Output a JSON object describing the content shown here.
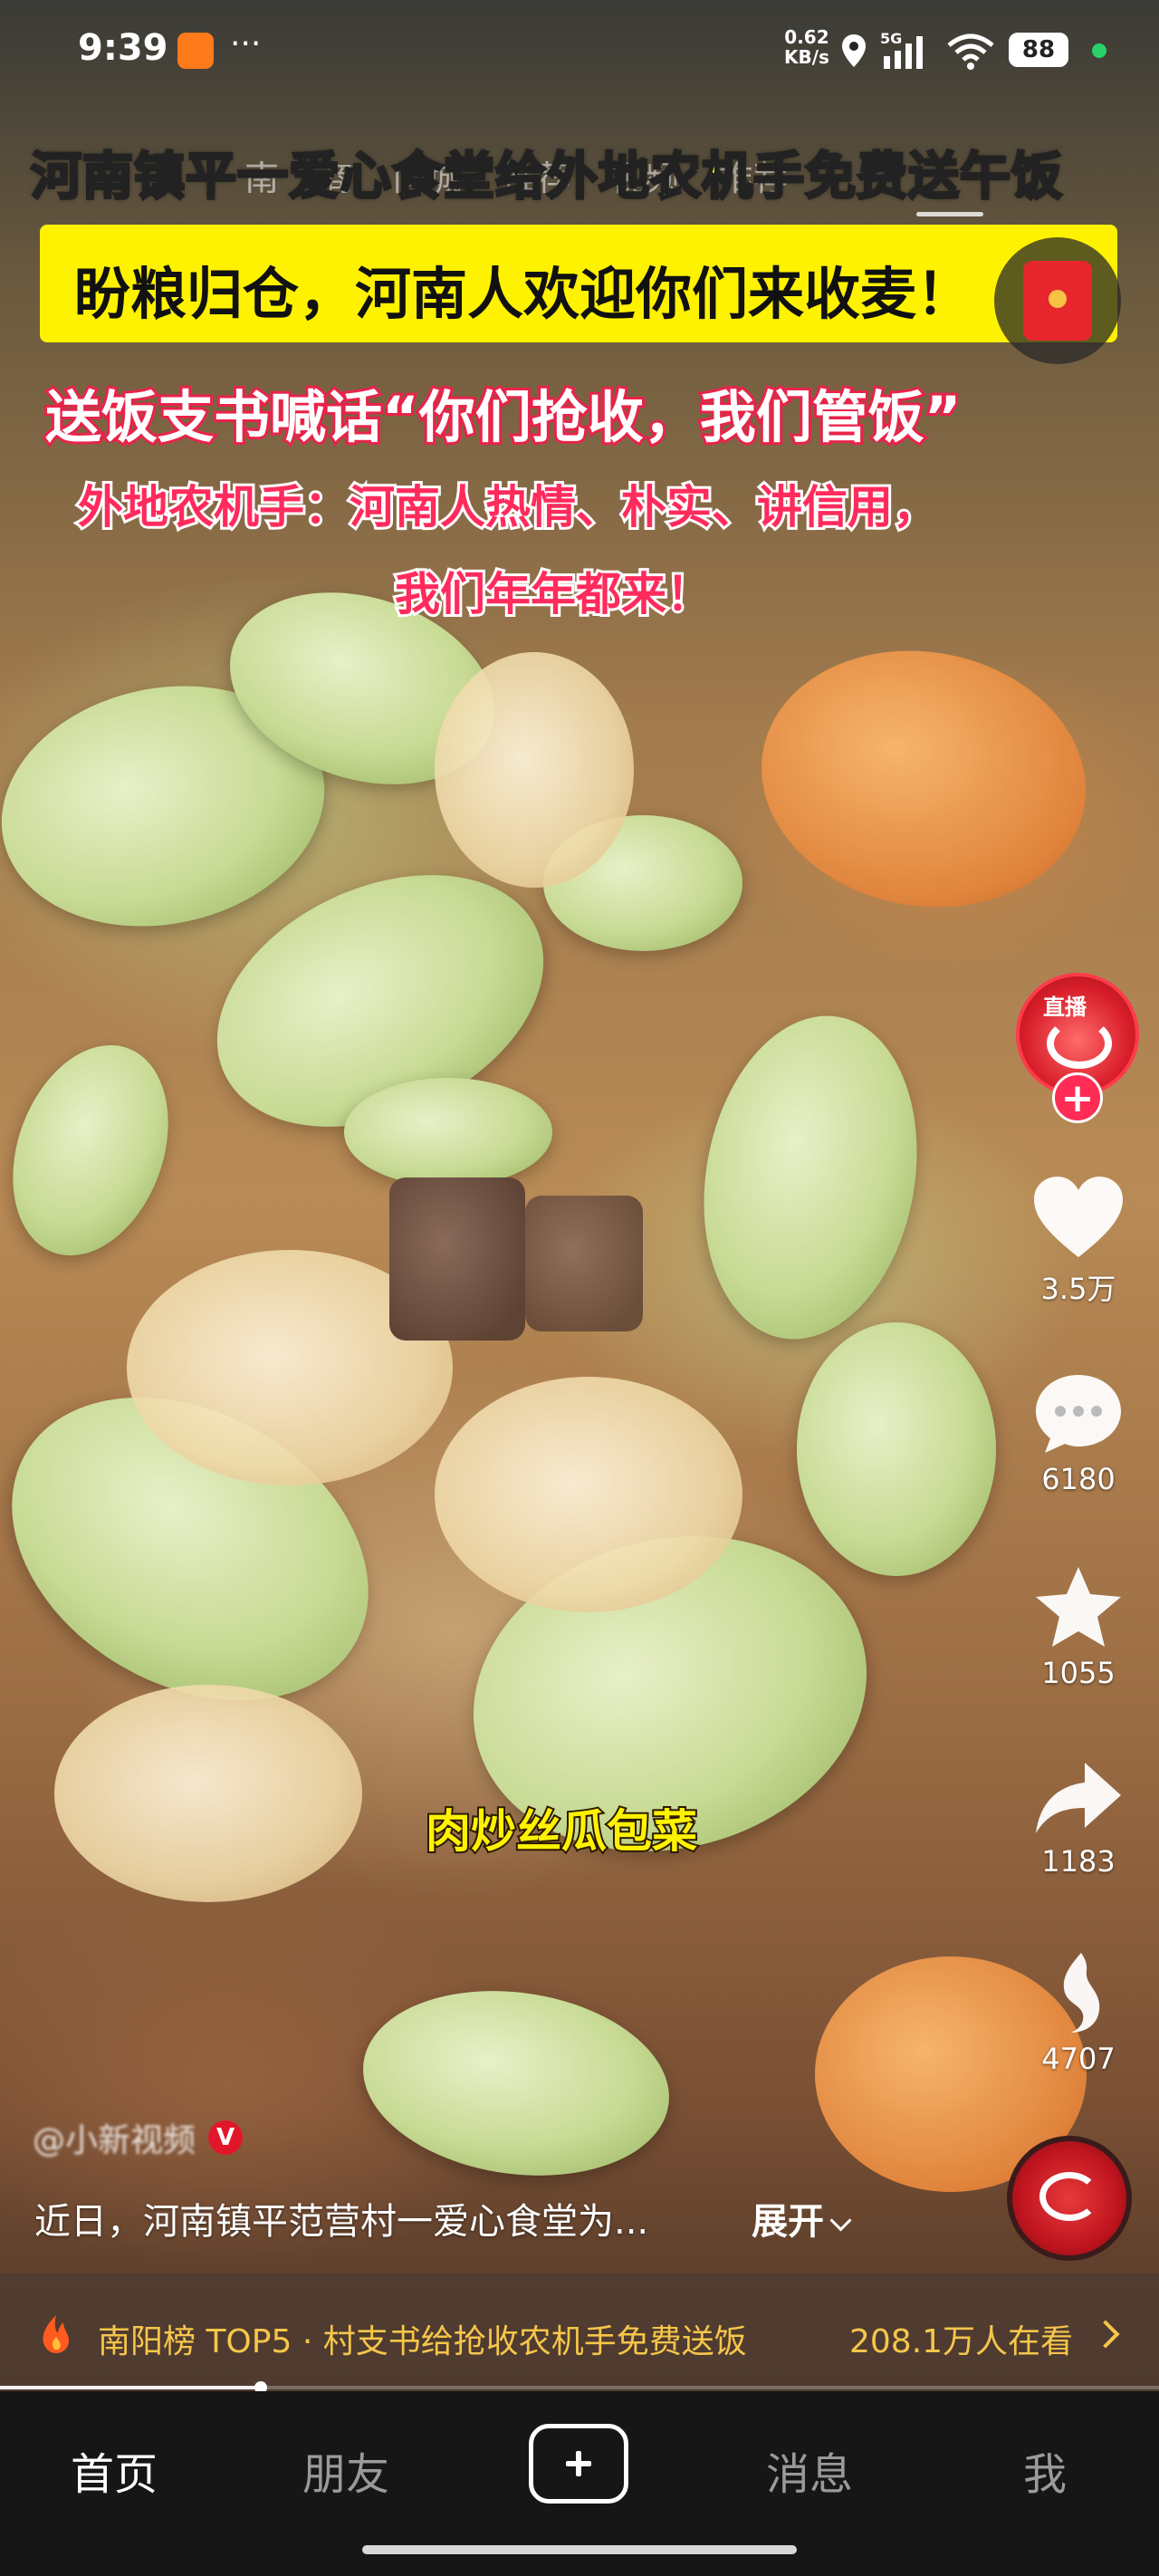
{
  "status_bar": {
    "time": "9:39",
    "dots": "···",
    "net_speed_value": "0.62",
    "net_speed_unit": "KB/s",
    "network": "5G",
    "battery": "88"
  },
  "top_tabs": [
    "南",
    "商",
    "同城",
    "推荐",
    "视频",
    "推荐"
  ],
  "captions": {
    "title": "河南镇平一爱心食堂给外地农机手免费送午饭",
    "box": "盼粮归仓，河南人欢迎你们来收麦！",
    "line3": "送饭支书喊话“你们抢收，我们管饭”",
    "line4": "外地农机手：河南人热情、朴实、讲信用，",
    "line5": "我们年年都来！",
    "dish": "肉炒丝瓜包菜"
  },
  "actions": {
    "live_label": "直播",
    "follow_plus": "+",
    "likes": "3.5万",
    "comments": "6180",
    "favorites": "1055",
    "shares": "1183",
    "recommend": "4707"
  },
  "author": {
    "name": "@小新视频",
    "verified_badge": "V"
  },
  "description": {
    "text": "近日，河南镇平范营村一爱心食堂为...",
    "expand": "展开"
  },
  "hotbar": {
    "text": "南阳榜 TOP5 · 村支书给抢收农机手免费送饭",
    "views": "208.1万人在看"
  },
  "progress": {
    "fraction": 0.225
  },
  "bottom_nav": {
    "home": "首页",
    "friends": "朋友",
    "messages": "消息",
    "me": "我"
  },
  "colors": {
    "caption_yellow": "#fff200",
    "caption_pink": "#ff2b5c",
    "accent_red": "#ff2c55",
    "hotbar_gold": "#f5c64a"
  }
}
